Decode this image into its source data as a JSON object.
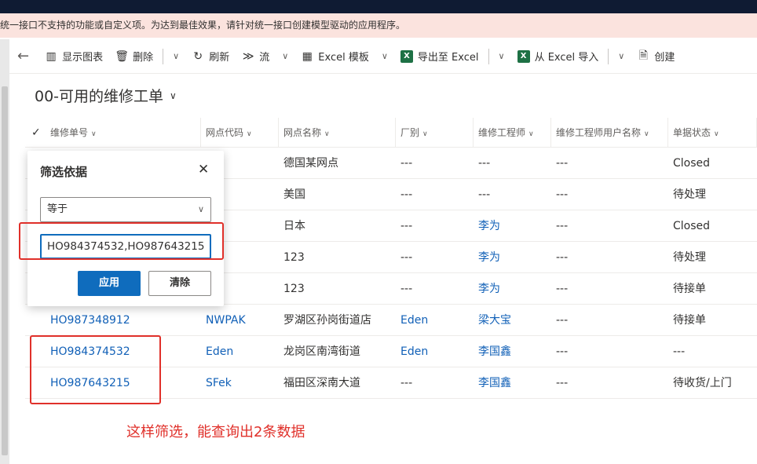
{
  "warning": {
    "text": "统一接口不支持的功能或自定义项。为达到最佳效果，请针对统一接口创建模型驱动的应用程序。"
  },
  "commandbar": {
    "back_icon": "arrow-left-icon",
    "show_chart": "显示图表",
    "delete": "删除",
    "refresh": "刷新",
    "flow": "流",
    "excel_template": "Excel 模板",
    "export_excel": "导出至 Excel",
    "import_excel": "从 Excel 导入",
    "create": "创建"
  },
  "view": {
    "title": "00-可用的维修工单"
  },
  "columns": [
    "维修单号",
    "网点代码",
    "网点名称",
    "厂别",
    "维修工程师",
    "维修工程师用户名称",
    "单据状态"
  ],
  "rows": [
    {
      "order": "",
      "code": "",
      "name": "德国某网点",
      "factory": "---",
      "engineer": "---",
      "engineer_user": "---",
      "status": "Closed"
    },
    {
      "order": "",
      "code": "",
      "name": "美国",
      "factory": "---",
      "engineer": "---",
      "engineer_user": "---",
      "status": "待处理"
    },
    {
      "order": "",
      "code": "",
      "name": "日本",
      "factory": "---",
      "engineer": "李为",
      "engineer_user": "---",
      "status": "Closed"
    },
    {
      "order": "",
      "code": "",
      "name": "123",
      "factory": "---",
      "engineer": "李为",
      "engineer_user": "---",
      "status": "待处理"
    },
    {
      "order": "",
      "code": "",
      "name": "123",
      "factory": "---",
      "engineer": "李为",
      "engineer_user": "---",
      "status": "待接单"
    },
    {
      "order": "HO987348912",
      "code": "NWPAK",
      "name": "罗湖区孙岗街道店",
      "factory": "Eden",
      "engineer": "梁大宝",
      "engineer_user": "---",
      "status": "待接单"
    },
    {
      "order": "HO984374532",
      "code": "Eden",
      "name": "龙岗区南湾街道",
      "factory": "Eden",
      "engineer": "李国鑫",
      "engineer_user": "---",
      "status": "---"
    },
    {
      "order": "HO987643215",
      "code": "SFek",
      "name": "福田区深南大道",
      "factory": "---",
      "engineer": "李国鑫",
      "engineer_user": "---",
      "status": "待收货/上门"
    }
  ],
  "filter_popup": {
    "title": "筛选依据",
    "operator": "等于",
    "value": "HO984374532,HO987643215",
    "apply": "应用",
    "clear": "清除"
  },
  "annotation": {
    "text": "这样筛选，能查询出2条数据"
  },
  "colors": {
    "accent": "#0f6cbd",
    "link": "#1160b7",
    "highlight": "#e0302a",
    "warning_bg": "#fbe3de"
  }
}
